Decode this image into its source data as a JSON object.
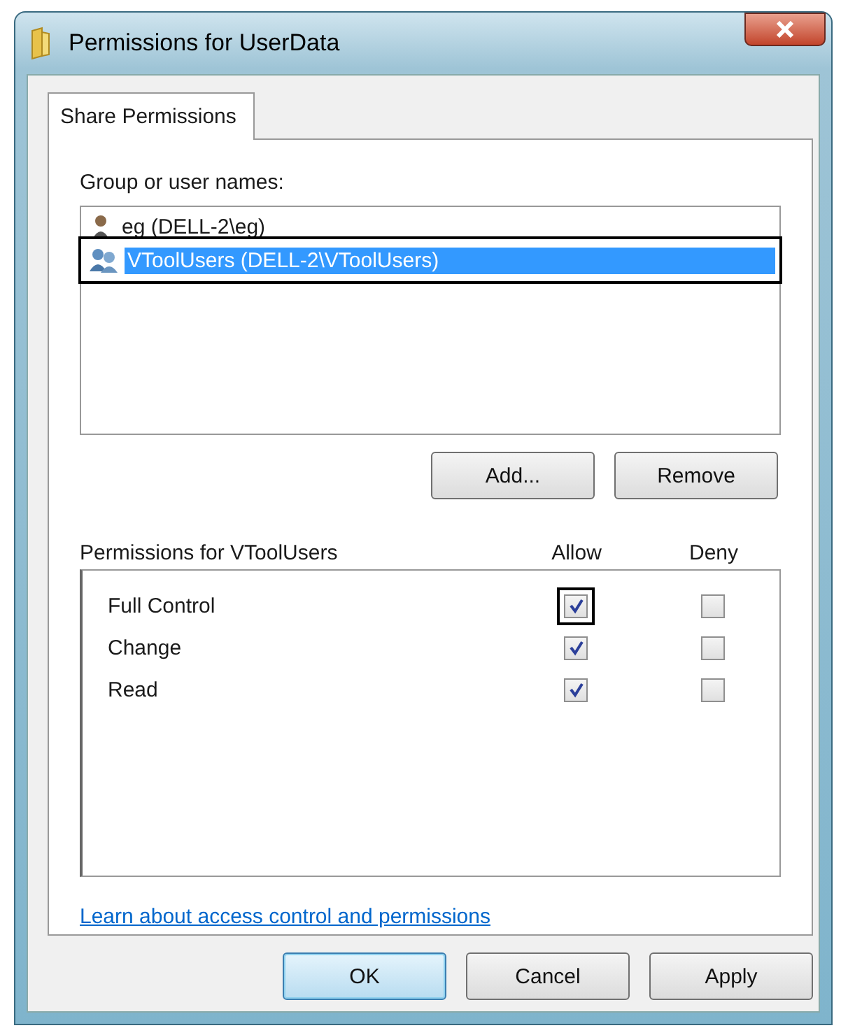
{
  "window": {
    "title": "Permissions for UserData"
  },
  "tabs": [
    {
      "label": "Share Permissions",
      "selected": true
    }
  ],
  "group_label": "Group or user names:",
  "users": [
    {
      "name": "eg (DELL-2\\eg)",
      "kind": "user",
      "selected": false,
      "highlighted": false
    },
    {
      "name": "VToolUsers (DELL-2\\VToolUsers)",
      "kind": "group",
      "selected": true,
      "highlighted": true
    }
  ],
  "user_buttons": [
    "Add...",
    "Remove"
  ],
  "permissions": {
    "label": "Permissions for VToolUsers",
    "columns": [
      "Allow",
      "Deny"
    ],
    "rows": [
      {
        "name": "Full Control",
        "allow": true,
        "deny": false,
        "allow_highlighted": true
      },
      {
        "name": "Change",
        "allow": true,
        "deny": false,
        "allow_highlighted": false
      },
      {
        "name": "Read",
        "allow": true,
        "deny": false,
        "allow_highlighted": false
      }
    ]
  },
  "link": "Learn about access control and permissions",
  "buttons": [
    {
      "label": "OK",
      "default": true
    },
    {
      "label": "Cancel",
      "default": false
    },
    {
      "label": "Apply",
      "default": false
    }
  ]
}
